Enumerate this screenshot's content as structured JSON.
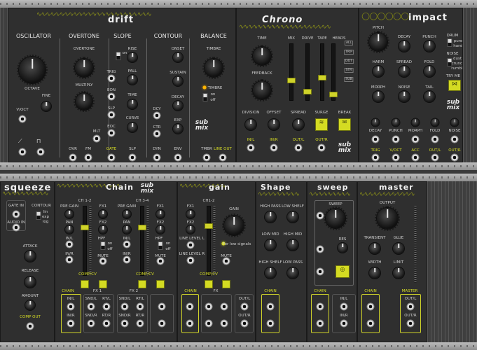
{
  "modules": {
    "drift": {
      "title": "drift",
      "sections": {
        "oscillator": "OSCILLATOR",
        "overtone": "OVERTONE",
        "slope": "SLOPE",
        "contour": "CONTOUR",
        "balance": "BALANCE"
      },
      "labels": {
        "octave": "OCTAVE",
        "fine": "FINE",
        "voct": "V/OCT",
        "overtone_knob": "OVERTONE",
        "multiply": "MULTIPLY",
        "mlt": "MLT",
        "ovr": "OVR",
        "fm": "FM",
        "on": "on",
        "rise": "RISE",
        "fall": "FALL",
        "time": "TIME",
        "curve": "CURVE",
        "trig": "TRIG",
        "eon": "EON",
        "slp": "SLP",
        "eoc": "EOC",
        "gate": "GATE",
        "slp_out": "SLP",
        "onset": "ONSET",
        "sustain": "SUSTAIN",
        "decay": "DECAY",
        "exp": "EXP",
        "dcy": "DCY",
        "ctr": "CTR",
        "dyn": "DYN",
        "env": "ENV",
        "timbre": "TIMBRE",
        "timbre_led": "TIMBRE",
        "tog_on": "on",
        "tog_off": "off",
        "tmbr": "TMBR",
        "line_out": "LINE OUT"
      }
    },
    "chrono": {
      "title": "Chrono",
      "labels": {
        "time": "TIME",
        "feedback": "FEEDBACK",
        "mix": "MIX",
        "drive": "DRIVE",
        "tape": "TAPE",
        "heads": "HEADS",
        "head_all": "ALL",
        "head_trip": "TRIP",
        "head_dot": "DOT",
        "head_str": "STR",
        "head_sub": "SUB",
        "division": "DIVISION",
        "offset": "OFFSET",
        "spread": "SPREAD",
        "surge": "SURGE",
        "break": "BREAK",
        "in_l": "IN/L",
        "in_r": "IN/R",
        "out_l": "OUT/L",
        "out_r": "OUT/R"
      }
    },
    "impact": {
      "title": "impact",
      "labels": {
        "pitch": "PITCH",
        "decay": "DECAY",
        "punch": "PUNCH",
        "drum": "DRUM",
        "pure": "pure",
        "harsh": "harsh",
        "harm": "HARM",
        "spread": "SPREAD",
        "fold": "FOLD",
        "noise": "NOISE",
        "dust": "dust",
        "crunch": "crunch",
        "rumble": "rumble",
        "try_me": "TRY ME",
        "morph": "MORPH",
        "noise_knob": "NOISE",
        "tail": "TAIL",
        "cv_decay": "DECAY",
        "cv_punch": "PUNCH",
        "cv_morph": "MORPH",
        "cv_fold": "FOLD",
        "cv_noise": "NOISE",
        "trig": "TRIG",
        "voct": "V/OCT",
        "acc": "ACC",
        "out_l": "OUT/L",
        "out_r": "OUT/R"
      }
    },
    "squeeze": {
      "title": "squeeze",
      "labels": {
        "gate_in": "GATE IN",
        "audio_in": "AUDIO IN",
        "contour": "CONTOUR",
        "lin": "lin",
        "exp": "exp",
        "log": "log",
        "attack": "ATTACK",
        "release": "RELEASE",
        "amount": "AMOUNT",
        "comp_out": "COMP OUT"
      }
    },
    "chain": {
      "title": "Chain",
      "labels": {
        "ch12": "CH 1-2",
        "ch34": "CH 3-4",
        "pre_gain": "PRE GAIN",
        "fx1": "FX1",
        "fx2": "FX2",
        "pan": "PAN",
        "hpf": "HPF",
        "on": "on",
        "off": "off",
        "in_l": "IN/L",
        "in_r": "IN/R",
        "mute": "MUTE",
        "comp_cv": "COMP/CV",
        "chain": "CHAIN",
        "fx1_group": "FX 1",
        "fx2_group": "FX 2",
        "snd_l": "SND/L",
        "snd_r": "SND/R",
        "rt_l": "RT/L",
        "rt_r": "RT/R"
      }
    },
    "gain": {
      "title": "gain",
      "labels": {
        "ch12": "CH1-2",
        "gain": "GAIN",
        "line_level_l": "LINE LEVEL L",
        "line_level_r": "LINE LEVEL R",
        "for_low": "For low signals",
        "mute": "MUTE",
        "comp_cv": "COMP/CV",
        "chain": "CHAIN",
        "fx": "FX",
        "out_l": "OUT/L",
        "out_r": "OUT/R"
      }
    },
    "shape": {
      "title": "Shape",
      "labels": {
        "high_pass": "HIGH PASS",
        "low_shelf": "LOW SHELF",
        "low_mid": "LOW MID",
        "high_mid": "HIGH MID",
        "high_shelf": "HIGH SHELF",
        "low_pass": "LOW PASS",
        "chain": "CHAIN"
      }
    },
    "sweep": {
      "title": "sweep",
      "labels": {
        "sweep": "SWEEP",
        "res": "RES",
        "chain": "CHAIN",
        "in_l": "IN/L",
        "in_r": "IN/R",
        "out_l": "OUT/L",
        "out_r": "OUT/R"
      }
    },
    "master": {
      "title": "master",
      "labels": {
        "output": "OUTPUT",
        "transient": "TRANSIENT",
        "glue": "GLUE",
        "width": "WIDTH",
        "limit": "LIMIT",
        "chain": "CHAIN",
        "master": "MASTER",
        "out_l": "OUT/L",
        "out_r": "OUT/R"
      }
    }
  },
  "brand": "sub\nmix",
  "colors": {
    "accent": "#d4db22",
    "panel": "#2f2f2f",
    "rail": "#a8a8a8",
    "led": "#ffb400"
  }
}
